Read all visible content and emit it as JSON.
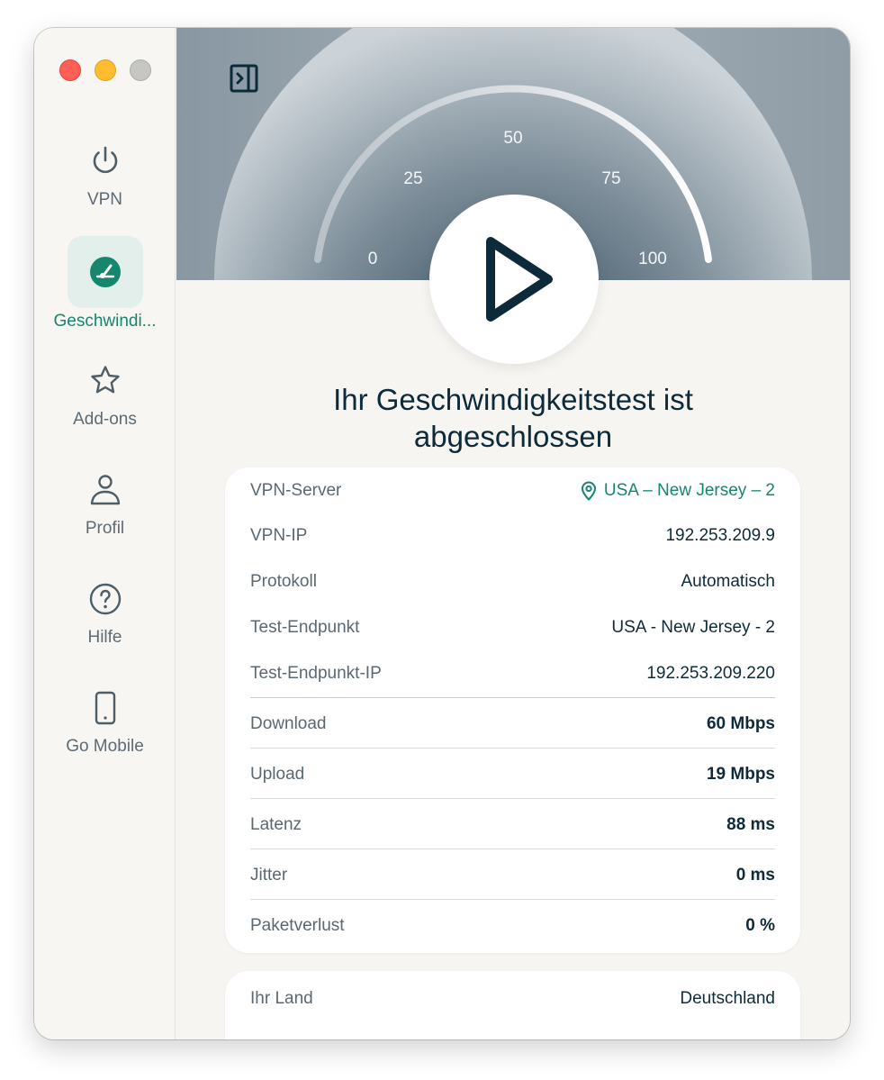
{
  "sidebar": {
    "items": [
      {
        "label": "VPN",
        "icon": "power-icon"
      },
      {
        "label": "Geschwindi...",
        "icon": "speedometer-icon",
        "active": true
      },
      {
        "label": "Add-ons",
        "icon": "star-icon"
      },
      {
        "label": "Profil",
        "icon": "user-icon"
      },
      {
        "label": "Hilfe",
        "icon": "help-icon"
      },
      {
        "label": "Go Mobile",
        "icon": "mobile-icon"
      }
    ]
  },
  "gauge": {
    "ticks": [
      "0",
      "25",
      "50",
      "75",
      "100"
    ]
  },
  "headline": {
    "line1": "Ihr Geschwindigkeitstest ist",
    "line2": "abgeschlossen"
  },
  "results": {
    "rows": [
      {
        "key": "VPN-Server",
        "value": "USA – New Jersey – 2"
      },
      {
        "key": "VPN-IP",
        "value": "192.253.209.9"
      },
      {
        "key": "Protokoll",
        "value": "Automatisch"
      },
      {
        "key": "Test-Endpunkt",
        "value": "USA - New Jersey - 2"
      },
      {
        "key": "Test-Endpunkt-IP",
        "value": "192.253.209.220"
      },
      {
        "key": "Download",
        "value": "60 Mbps"
      },
      {
        "key": "Upload",
        "value": "19 Mbps"
      },
      {
        "key": "Latenz",
        "value": "88 ms"
      },
      {
        "key": "Jitter",
        "value": "0 ms"
      },
      {
        "key": "Paketverlust",
        "value": "0 %"
      }
    ]
  },
  "location": {
    "rows": [
      {
        "key": "Ihr Land",
        "value": "Deutschland"
      }
    ]
  },
  "colors": {
    "accent": "#16866d",
    "text_dark": "#0d2a3a"
  }
}
